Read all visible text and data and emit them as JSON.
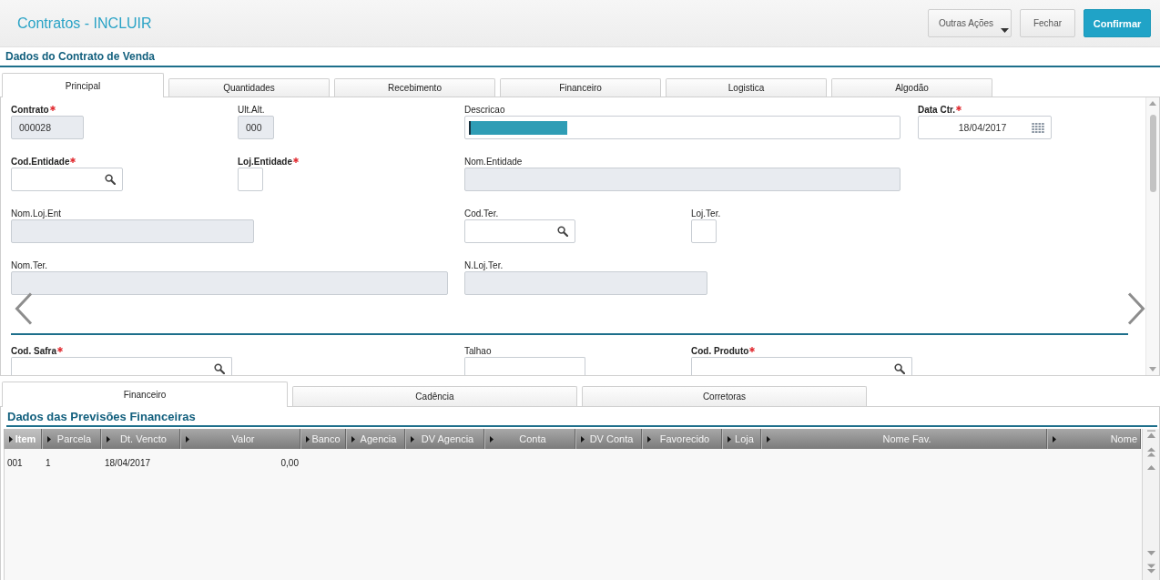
{
  "header": {
    "title": "Contratos - INCLUIR",
    "buttons": [
      {
        "label": "Outras Ações",
        "kind": "menu"
      },
      {
        "label": "Fechar",
        "kind": "secondary"
      },
      {
        "label": "Confirmar",
        "kind": "primary"
      }
    ]
  },
  "contract_section": {
    "title": "Dados do Contrato de Venda",
    "tabs": [
      {
        "label": "Principal",
        "selected": true
      },
      {
        "label": "Quantidades",
        "selected": false
      },
      {
        "label": "Recebimento",
        "selected": false
      },
      {
        "label": "Financeiro",
        "selected": false
      },
      {
        "label": "Logistica",
        "selected": false
      },
      {
        "label": "Algodão",
        "selected": false
      }
    ],
    "form_groups": [
      {
        "rows": [
          [
            {
              "label": "Contrato",
              "required": true,
              "kind": "readonly",
              "value": "000028"
            },
            {
              "label": "Ult.Alt.",
              "required": false,
              "kind": "readonly",
              "value": "000"
            },
            {
              "label": "Descricao",
              "required": false,
              "kind": "text",
              "text_selected": true
            },
            {
              "label": "Data Ctr.",
              "required": true,
              "kind": "date",
              "value": "18/04/2017"
            }
          ],
          [
            {
              "label": "Cod.Entidade",
              "required": true,
              "kind": "lookup"
            },
            {
              "label": "Loj.Entidade",
              "required": true,
              "kind": "text",
              "text_selected": false
            },
            {
              "label": "Nom.Entidade",
              "required": false,
              "kind": "readonly"
            }
          ],
          [
            {
              "label": "Nom.Loj.Ent",
              "required": false,
              "kind": "readonly"
            },
            {
              "label": "Cod.Ter.",
              "required": false,
              "kind": "lookup"
            },
            {
              "label": "Loj.Ter.",
              "required": false,
              "kind": "text",
              "text_selected": false
            }
          ],
          [
            {
              "label": "Nom.Ter.",
              "required": false,
              "kind": "readonly"
            },
            {
              "label": "N.Loj.Ter.",
              "required": false,
              "kind": "readonly"
            }
          ]
        ]
      },
      {
        "rows": [
          [
            {
              "label": "Cod. Safra",
              "required": true,
              "kind": "lookup"
            },
            {
              "label": "Talhao",
              "required": false,
              "kind": "text",
              "text_selected": false
            },
            {
              "label": "Cod. Produto",
              "required": true,
              "kind": "lookup"
            }
          ]
        ]
      }
    ]
  },
  "detail_section": {
    "tabs": [
      {
        "label": "Financeiro",
        "selected": true
      },
      {
        "label": "Cadência",
        "selected": false
      },
      {
        "label": "Corretoras",
        "selected": false
      }
    ],
    "title": "Dados das Previsões Financeiras",
    "table": {
      "columns": [
        {
          "label": "Item",
          "selected": true
        },
        {
          "label": "Parcela",
          "selected": false
        },
        {
          "label": "Dt. Vencto",
          "selected": false
        },
        {
          "label": "Valor",
          "selected": false
        },
        {
          "label": "Banco",
          "selected": false
        },
        {
          "label": "Agencia",
          "selected": false
        },
        {
          "label": "DV Agencia",
          "selected": false
        },
        {
          "label": "Conta",
          "selected": false
        },
        {
          "label": "DV Conta",
          "selected": false
        },
        {
          "label": "Favorecido",
          "selected": false
        },
        {
          "label": "Loja",
          "selected": false
        },
        {
          "label": "Nome Fav.",
          "selected": false
        },
        {
          "label": "Nome",
          "selected": false
        }
      ],
      "rows": [
        [
          "001",
          "1",
          "18/04/2017",
          "0,00"
        ]
      ]
    }
  }
}
